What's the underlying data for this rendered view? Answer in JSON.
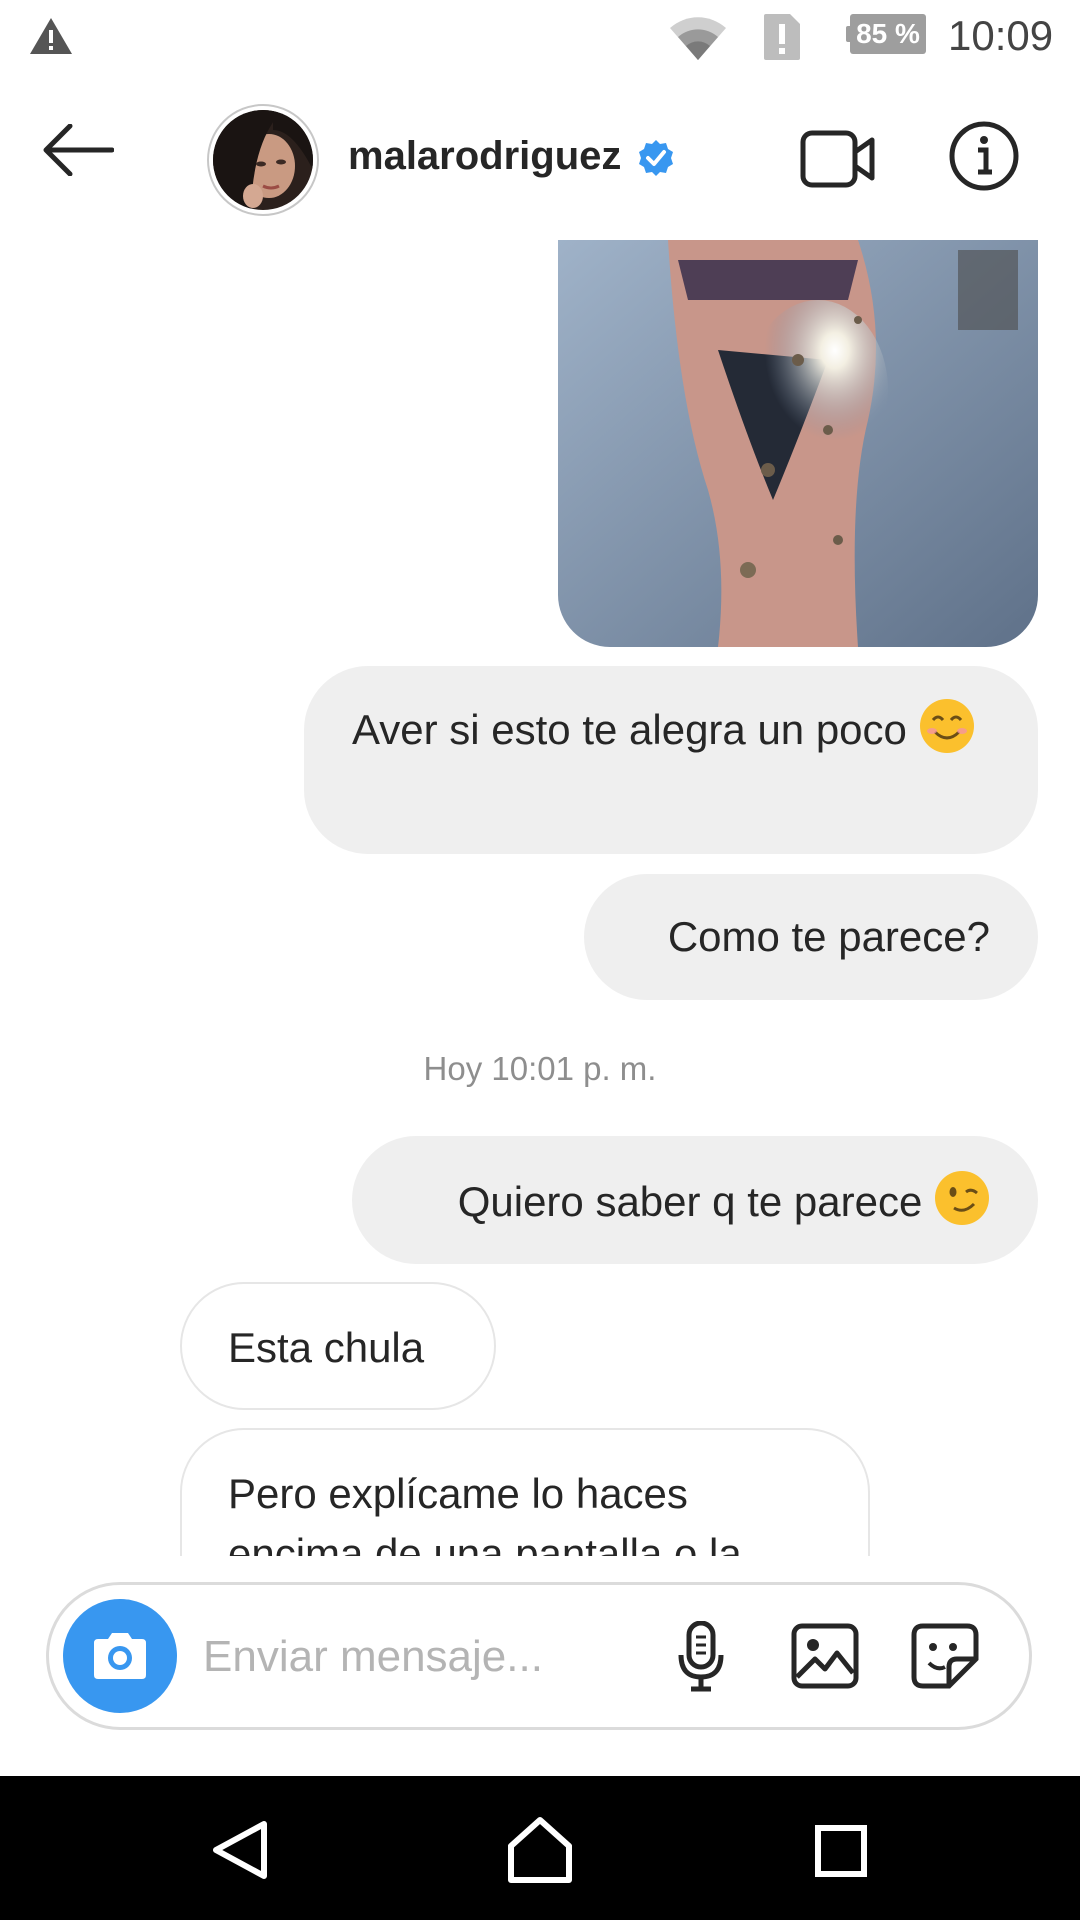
{
  "status_bar": {
    "battery": "85 %",
    "time": "10:09",
    "icons": [
      "warning-icon",
      "wifi-icon",
      "alert-icon",
      "battery-icon"
    ]
  },
  "header": {
    "username": "malarodriguez",
    "verified": true,
    "icons": [
      "back-arrow-icon",
      "video-call-icon",
      "info-icon",
      "verified-badge-icon"
    ]
  },
  "messages": [
    {
      "direction": "outgoing",
      "type": "image"
    },
    {
      "direction": "outgoing",
      "type": "text",
      "text": "Aver si esto te alegra un poco",
      "emoji": "smiling-face-emoji"
    },
    {
      "direction": "outgoing",
      "type": "text",
      "text": "Como te parece?"
    },
    {
      "direction": "outgoing",
      "type": "text",
      "text": "Quiero saber q te parece",
      "emoji": "winking-face-emoji"
    },
    {
      "direction": "incoming",
      "type": "text",
      "text": "Esta chula"
    },
    {
      "direction": "incoming",
      "type": "text",
      "text": "Pero explícame lo haces encima de una pantalla o la"
    }
  ],
  "timestamp": "Hoy 10:01 p. m.",
  "composer": {
    "placeholder": "Enviar mensaje...",
    "icons": [
      "camera-icon",
      "microphone-icon",
      "gallery-icon",
      "sticker-icon"
    ]
  },
  "navigation": {
    "icons": [
      "nav-back-icon",
      "nav-home-icon",
      "nav-recents-icon"
    ]
  },
  "colors": {
    "accent": "#3897f0",
    "outgoing_bubble": "#efefef",
    "incoming_border": "#e6e6e6",
    "verified": "#3897f0"
  }
}
